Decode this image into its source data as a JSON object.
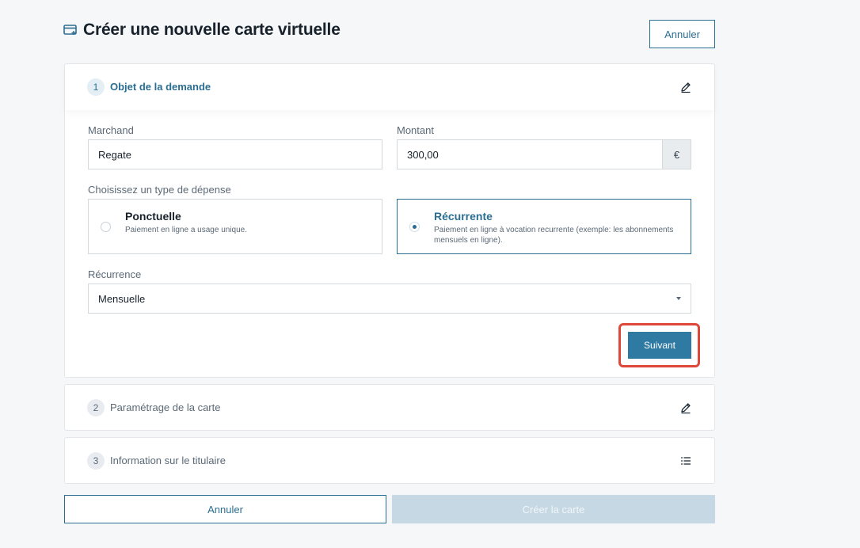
{
  "header": {
    "title": "Créer une nouvelle carte virtuelle",
    "cancel_label": "Annuler",
    "icon": "credit-card-add-icon"
  },
  "steps": [
    {
      "number": "1",
      "title": "Objet de la demande",
      "icon": "edit-pencil-icon",
      "active": true
    },
    {
      "number": "2",
      "title": "Paramétrage de la carte",
      "icon": "edit-pencil-icon",
      "active": false
    },
    {
      "number": "3",
      "title": "Information sur le titulaire",
      "icon": "list-icon",
      "active": false
    }
  ],
  "form": {
    "merchant": {
      "label": "Marchand",
      "value": "Regate"
    },
    "amount": {
      "label": "Montant",
      "value": "300,00",
      "currency": "€"
    },
    "expense_type": {
      "label": "Choisissez un type de dépense",
      "options": [
        {
          "title": "Ponctuelle",
          "description": "Paiement en ligne a usage unique.",
          "selected": false
        },
        {
          "title": "Récurrente",
          "description": "Paiement en ligne à vocation recurrente (exemple: les abonnements mensuels en ligne).",
          "selected": true
        }
      ]
    },
    "recurrence": {
      "label": "Récurrence",
      "value": "Mensuelle"
    },
    "next_label": "Suivant"
  },
  "footer": {
    "cancel_label": "Annuler",
    "create_label": "Créer la carte"
  },
  "colors": {
    "accent": "#2b6e92",
    "primary_button": "#2f7aa3",
    "disabled_button": "#c5d8e3",
    "highlight": "#e0473b",
    "background": "#f6f7f9"
  }
}
